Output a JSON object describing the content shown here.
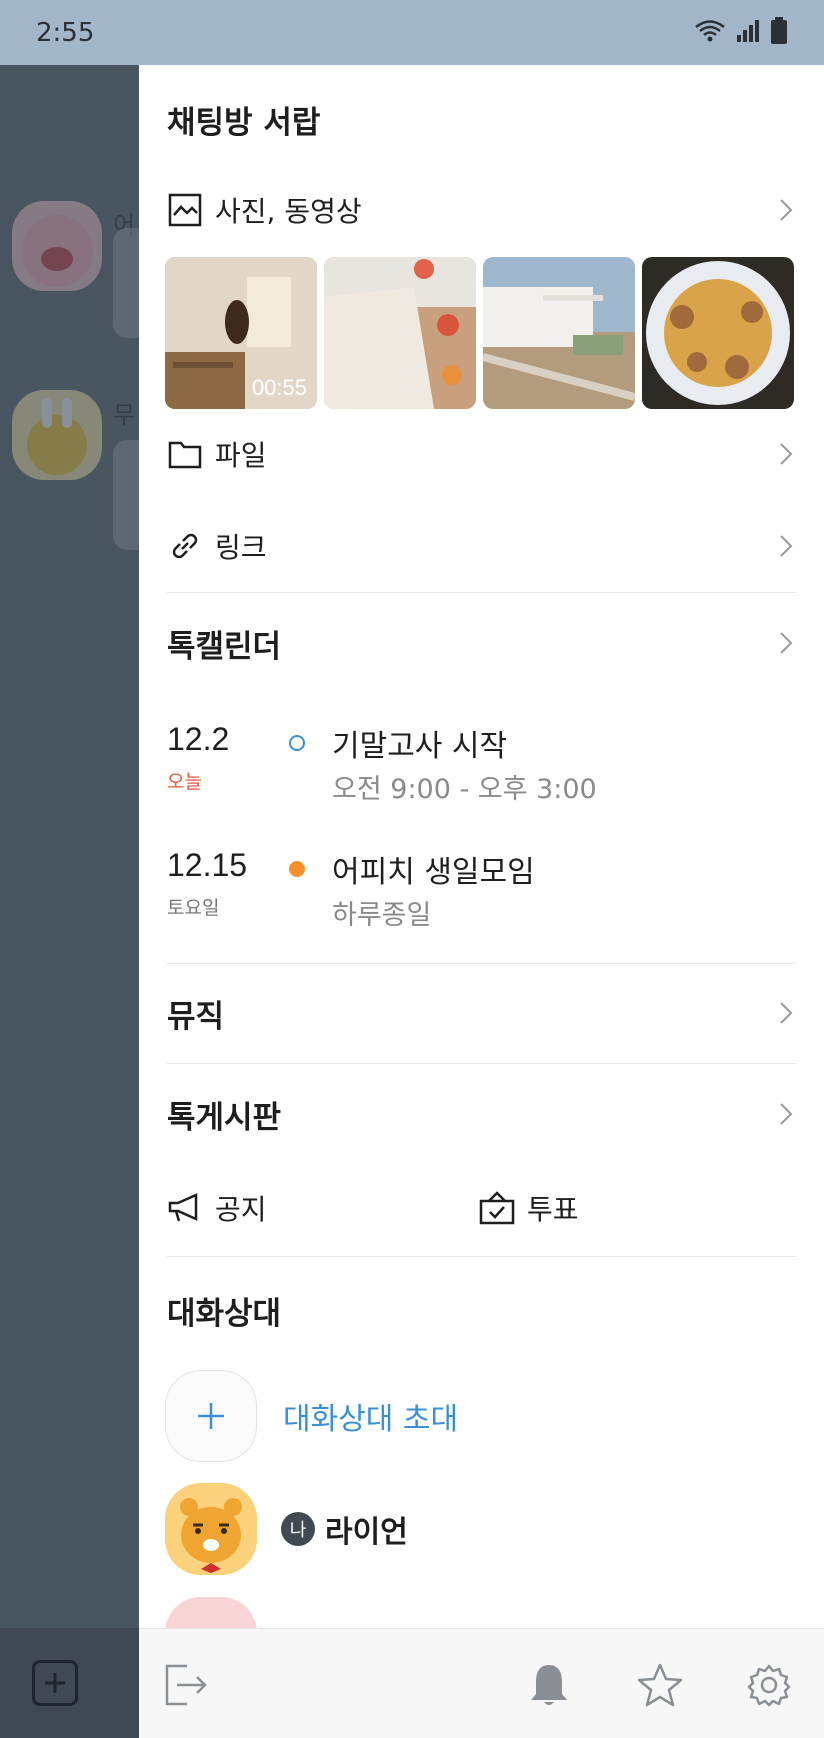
{
  "status_bar": {
    "time": "2:55"
  },
  "chat_background": {
    "names": [
      "어",
      "무"
    ]
  },
  "drawer": {
    "title": "채팅방 서랍",
    "media": {
      "label": "사진, 동영상",
      "thumbnails": [
        {
          "duration": "00:55"
        },
        {
          "duration": ""
        },
        {
          "duration": ""
        },
        {
          "duration": ""
        }
      ]
    },
    "file": {
      "label": "파일"
    },
    "link": {
      "label": "링크"
    },
    "calendar": {
      "title": "톡캘린더",
      "events": [
        {
          "date": "12.2",
          "day": "오늘",
          "day_color": "#e8553b",
          "dot_style": "hollow",
          "dot_color": "#3a8fd8",
          "title": "기말고사 시작",
          "time": "오전 9:00 - 오후 3:00"
        },
        {
          "date": "12.15",
          "day": "토요일",
          "day_color": "#777777",
          "dot_style": "filled",
          "dot_color": "#f5902a",
          "title": "어피치 생일모임",
          "time": "하루종일"
        }
      ]
    },
    "music": {
      "title": "뮤직"
    },
    "board": {
      "title": "톡게시판",
      "notice_label": "공지",
      "vote_label": "투표"
    },
    "members": {
      "title": "대화상대",
      "invite_label": "대화상대 초대",
      "me_badge": "나",
      "me_name": "라이언"
    }
  },
  "colors": {
    "accent_blue": "#3a8fd8",
    "today_red": "#e8553b",
    "event_orange": "#f5902a"
  }
}
